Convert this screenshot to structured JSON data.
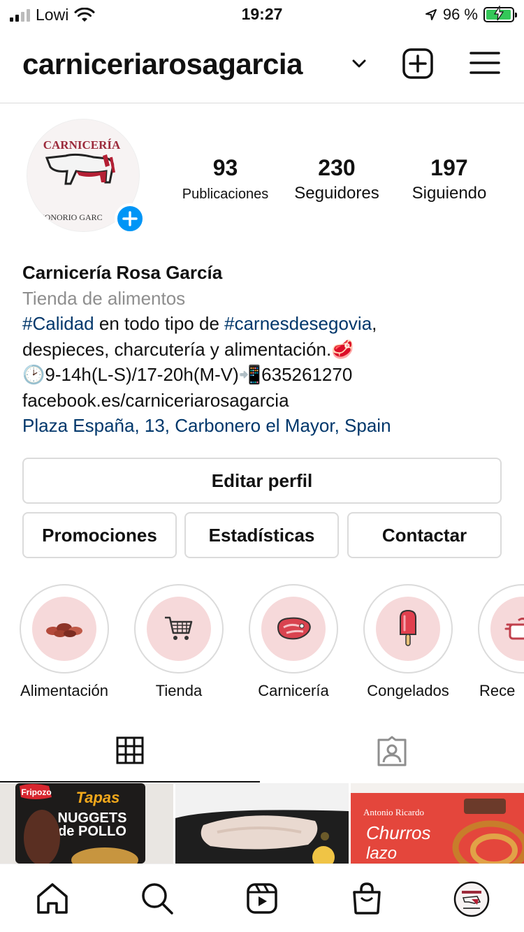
{
  "status_bar": {
    "carrier": "Lowi",
    "time": "19:27",
    "battery_percent": "96 %",
    "icons": [
      "signal-icon",
      "wifi-icon",
      "location-arrow-icon",
      "battery-charging-icon"
    ]
  },
  "header": {
    "username": "carniceriarosagarcia",
    "icons": [
      "chevron-down-icon",
      "new-post-icon",
      "menu-icon"
    ]
  },
  "profile": {
    "avatar_logo_text": [
      "CARNICERÍA",
      "HONORIO GARC"
    ],
    "stats": [
      {
        "value": "93",
        "label": "Publicaciones"
      },
      {
        "value": "230",
        "label": "Seguidores"
      },
      {
        "value": "197",
        "label": "Siguiendo"
      }
    ],
    "name": "Carnicería Rosa García",
    "category": "Tienda de alimentos",
    "bio": {
      "line1_tag1": "#Calidad",
      "line1_mid": " en todo tipo de ",
      "line1_tag2": "#carnesdesegovia",
      "line1_end": ",",
      "line2": "despieces, charcutería y alimentación.🥩",
      "line3": "🕑9-14h(L-S)/17-20h(M-V)📲635261270",
      "line4": "facebook.es/carniceriarosagarcia"
    },
    "location": "Plaza España, 13, Carbonero el Mayor, Spain"
  },
  "buttons": {
    "edit": "Editar perfil",
    "promotions": "Promociones",
    "statistics": "Estadísticas",
    "contact": "Contactar"
  },
  "highlights": [
    {
      "label": "Alimentación",
      "icon": "food-icon"
    },
    {
      "label": "Tienda",
      "icon": "shopping-cart-icon"
    },
    {
      "label": "Carnicería",
      "icon": "steak-icon"
    },
    {
      "label": "Congelados",
      "icon": "popsicle-icon"
    },
    {
      "label": "Rece",
      "icon": "cooking-pot-icon"
    }
  ],
  "tabs": [
    {
      "icon": "grid-icon",
      "active": true
    },
    {
      "icon": "tagged-icon",
      "active": false
    }
  ],
  "posts": [
    {
      "brand": "Fripozo",
      "product_lines": [
        "Tapas",
        "NUGGETS",
        "de POLLO"
      ]
    },
    {
      "description": "fish-fillet"
    },
    {
      "brand": "Antonio Ricardo",
      "product_lines": [
        "Churros",
        "lazo"
      ]
    }
  ],
  "bottom_nav": [
    "home-icon",
    "search-icon",
    "reels-icon",
    "shop-icon",
    "profile-avatar"
  ],
  "colors": {
    "link": "#00376b",
    "secondary_text": "#8e8e8e",
    "accent_blue": "#0095f6",
    "highlight_bg": "#f6d9da",
    "battery_green": "#34c759"
  }
}
